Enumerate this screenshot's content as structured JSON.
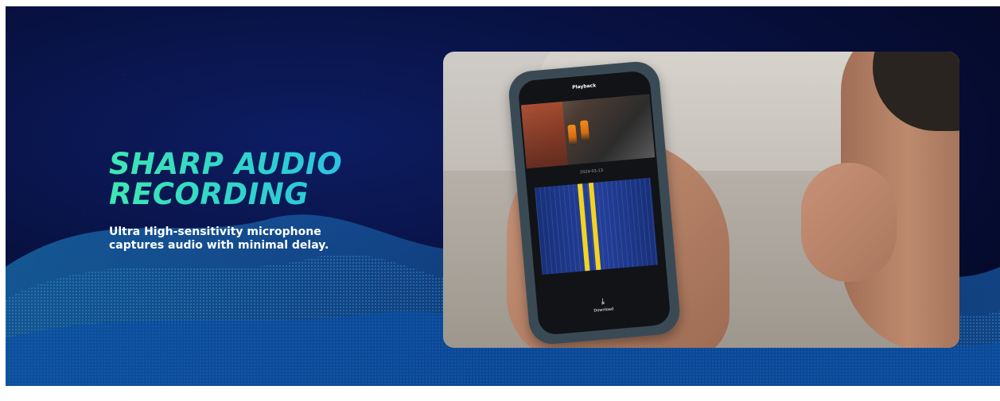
{
  "hero": {
    "title_line1": "SHARP AUDIO",
    "title_line2": "RECORDING",
    "subtitle": "Ultra High-sensitivity microphone captures audio with minimal delay."
  },
  "phone_screen": {
    "title": "Playback",
    "date": "2024-03-13",
    "download_label": "Download",
    "download_icon": "download-icon"
  },
  "colors": {
    "background": "#050b2e",
    "title_gradient_start": "#3ee8b2",
    "title_gradient_end": "#2bb8f0",
    "timeline_blue": "#24409b",
    "timeline_marker": "#f2d323"
  }
}
